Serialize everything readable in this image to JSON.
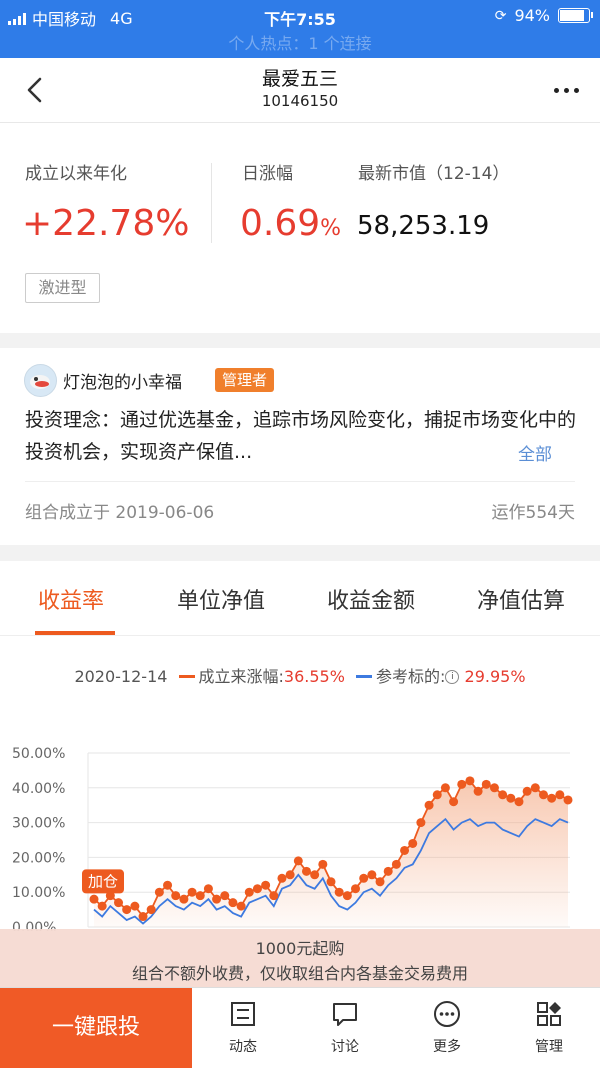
{
  "status_bar": {
    "carrier": "中国移动",
    "network": "4G",
    "time": "下午7:55",
    "battery": "94%",
    "battery_level": 0.94,
    "hotspot": "个人热点：1 个连接"
  },
  "nav": {
    "title": "最爱五三",
    "code": "10146150"
  },
  "summary": {
    "annual_label": "成立以来年化",
    "annual_value": "+22.78%",
    "daily_label": "日涨幅",
    "daily_value": "0.69",
    "daily_unit": "%",
    "market_label": "最新市值（12-14）",
    "market_value": "58,253.19",
    "risk_tag": "激进型"
  },
  "manager": {
    "name": "灯泡泡的小幸福",
    "badge": "管理者",
    "philosophy": "投资理念：通过优选基金，追踪市场风险变化，捕捉市场变化中的投资机会，实现资产保值...",
    "more": "全部",
    "founded": "组合成立于 2019-06-06",
    "running": "运作554天"
  },
  "tabs": [
    {
      "label": "收益率",
      "active": true
    },
    {
      "label": "单位净值",
      "active": false
    },
    {
      "label": "收益金额",
      "active": false
    },
    {
      "label": "净值估算",
      "active": false
    }
  ],
  "legend": {
    "date": "2020-12-14",
    "series1_label": "成立来涨幅:",
    "series1_value": "36.55%",
    "series2_label": "参考标的:",
    "series2_value": "29.95%"
  },
  "chart_data": {
    "type": "line",
    "y_ticks": [
      "50.00%",
      "40.00%",
      "30.00%",
      "20.00%",
      "10.00%",
      "0.00%"
    ],
    "ylim": [
      0,
      50
    ],
    "annotation": "加仓",
    "series": [
      {
        "color": "#ed5a1f",
        "values": [
          8,
          6,
          9,
          7,
          5,
          6,
          3,
          5,
          10,
          12,
          9,
          8,
          10,
          9,
          11,
          8,
          9,
          7,
          6,
          10,
          11,
          12,
          9,
          14,
          15,
          19,
          16,
          15,
          18,
          13,
          10,
          9,
          11,
          14,
          15,
          13,
          16,
          18,
          22,
          24,
          30,
          35,
          38,
          40,
          36,
          41,
          42,
          39,
          41,
          40,
          38,
          37,
          36,
          39,
          40,
          38,
          37,
          38,
          36.5
        ]
      },
      {
        "color": "#3d7ae0",
        "values": [
          5,
          3,
          6,
          4,
          2,
          3,
          1,
          3,
          6,
          8,
          6,
          5,
          7,
          6,
          8,
          5,
          6,
          4,
          3,
          7,
          8,
          9,
          6,
          11,
          12,
          15,
          12,
          11,
          14,
          9,
          6,
          5,
          7,
          10,
          11,
          9,
          12,
          14,
          17,
          18,
          22,
          27,
          29,
          31,
          28,
          30,
          31,
          29,
          30,
          30,
          28,
          27,
          26,
          29,
          31,
          30,
          29,
          31,
          30
        ]
      }
    ]
  },
  "buy": {
    "line1": "1000元起购",
    "line2": "组合不额外收费，仅收取组合内各基金交易费用"
  },
  "bottom": {
    "follow": "一键跟投",
    "items": [
      "动态",
      "讨论",
      "更多",
      "管理"
    ]
  },
  "colors": {
    "accent": "#ed5a1f",
    "status_blue": "#2f7ce8",
    "link_blue": "#5a8ed5"
  }
}
